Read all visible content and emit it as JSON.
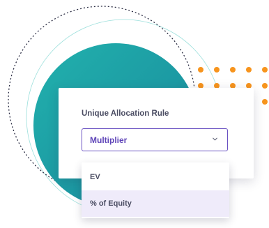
{
  "colors": {
    "accent": "#5e44b8",
    "select_border": "#6a52c2",
    "teal": "#1fa3a8",
    "orange_dots": "#f7941d",
    "highlight_option": "#efebfa"
  },
  "allocation_rule": {
    "label": "Unique Allocation Rule",
    "selected_value": "Multiplier",
    "chevron_icon": "chevron-down-icon"
  },
  "dropdown": {
    "options": [
      {
        "label": "EV"
      },
      {
        "label": "% of Equity",
        "highlighted": true
      }
    ]
  }
}
